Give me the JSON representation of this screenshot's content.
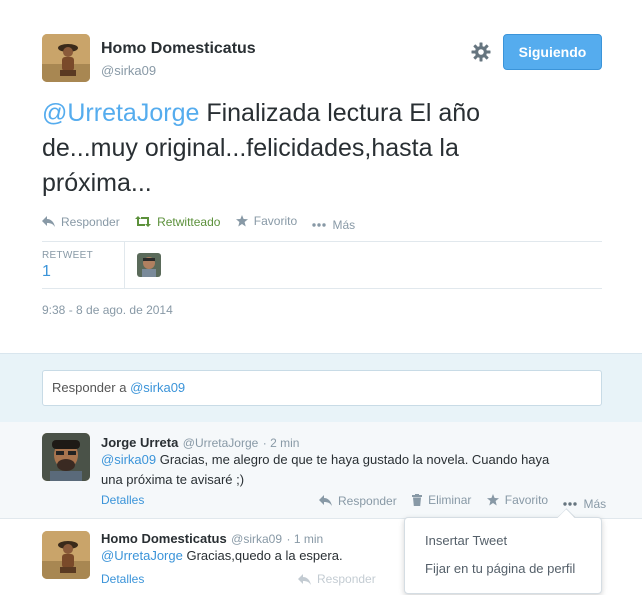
{
  "author": {
    "name": "Homo Domesticatus",
    "handle": "@sirka09"
  },
  "follow_button_label": "Siguiendo",
  "tweet": {
    "mention": "@UrretaJorge",
    "text_line1_rest": " Finalizada lectura El año",
    "text_line2": "de...muy original...felicidades,hasta la",
    "text_line3": "próxima..."
  },
  "actions": {
    "reply": "Responder",
    "retweeted": "Retwitteado",
    "favorite": "Favorito",
    "more": "Más"
  },
  "stats": {
    "retweet_label": "RETWEET",
    "retweet_count": "1"
  },
  "timestamp": "9:38 - 8 de ago. de 2014",
  "reply_box": {
    "prefix": "Responder a ",
    "handle": "@sirka09"
  },
  "replies": [
    {
      "name": "Jorge Urreta",
      "handle": "@UrretaJorge",
      "time": "· 2 min",
      "mention": "@sirka09",
      "text_line1": " Gracias, me alegro de que te haya gustado la novela. Cuando haya",
      "text_line2": "una próxima te avisaré ;)",
      "details": "Detalles",
      "reply": "Responder",
      "delete": "Eliminar",
      "favorite": "Favorito",
      "more": "Más"
    },
    {
      "name": "Homo Domesticatus",
      "handle": "@sirka09",
      "time": "· 1 min",
      "mention": "@UrretaJorge",
      "text": " Gracias,quedo a la espera.",
      "details": "Detalles",
      "reply": "Responder"
    }
  ],
  "more_menu": {
    "items": [
      "Insertar Tweet",
      "Fijar en tu página de perfil"
    ]
  },
  "colors": {
    "accent": "#55acee",
    "retweet_green": "#5c913b",
    "muted": "#8899a6"
  }
}
